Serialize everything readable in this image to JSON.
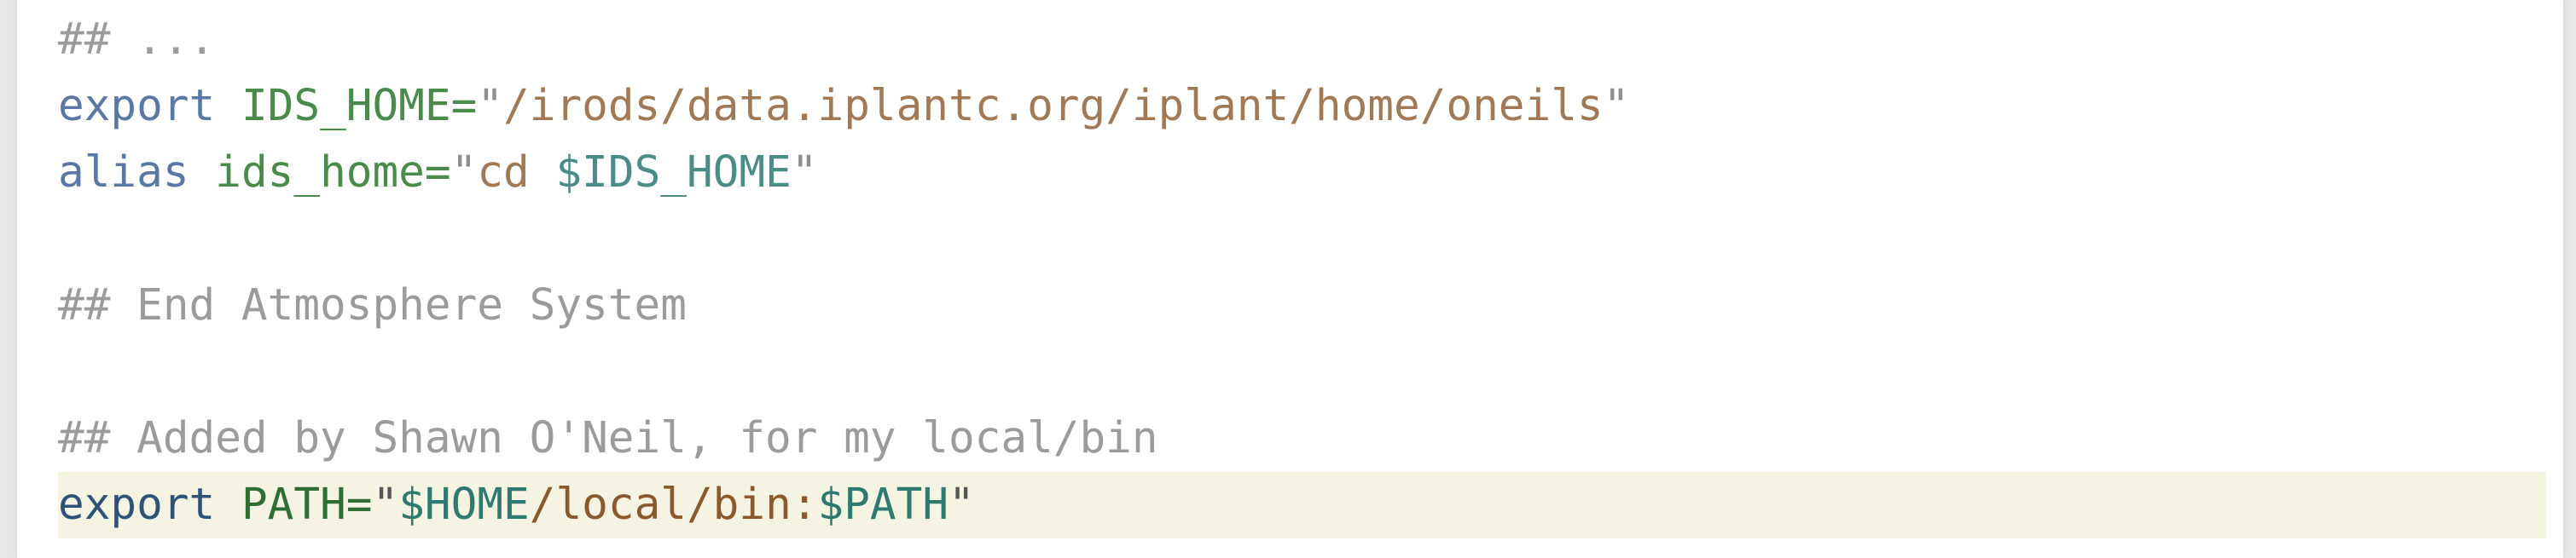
{
  "editor": {
    "lines": [
      {
        "tokens": [
          {
            "t": "comment",
            "v": "## ..."
          }
        ]
      },
      {
        "tokens": [
          {
            "t": "keyword",
            "v": "export"
          },
          {
            "t": "op",
            "v": " "
          },
          {
            "t": "var",
            "v": "IDS_HOME"
          },
          {
            "t": "var",
            "v": "="
          },
          {
            "t": "quote",
            "v": "\""
          },
          {
            "t": "string",
            "v": "/irods/data.iplantc.org/iplant/home/oneils"
          },
          {
            "t": "quote",
            "v": "\""
          }
        ]
      },
      {
        "tokens": [
          {
            "t": "keyword",
            "v": "alias"
          },
          {
            "t": "op",
            "v": " "
          },
          {
            "t": "var",
            "v": "ids_home"
          },
          {
            "t": "var",
            "v": "="
          },
          {
            "t": "quote",
            "v": "\""
          },
          {
            "t": "string",
            "v": "cd "
          },
          {
            "t": "dollar",
            "v": "$IDS_HOME"
          },
          {
            "t": "quote",
            "v": "\""
          }
        ]
      },
      {
        "tokens": []
      },
      {
        "tokens": [
          {
            "t": "comment",
            "v": "## End Atmosphere System"
          }
        ]
      },
      {
        "tokens": []
      },
      {
        "tokens": [
          {
            "t": "comment",
            "v": "## Added by Shawn O'Neil, for my local/bin"
          }
        ]
      },
      {
        "current": true,
        "tokens": [
          {
            "t": "keyword",
            "v": "export"
          },
          {
            "t": "op",
            "v": " "
          },
          {
            "t": "var",
            "v": "PATH"
          },
          {
            "t": "var",
            "v": "="
          },
          {
            "t": "quote",
            "v": "\""
          },
          {
            "t": "dollar",
            "v": "$HOME"
          },
          {
            "t": "string",
            "v": "/local/bin:"
          },
          {
            "t": "dollar",
            "v": "$PATH"
          },
          {
            "t": "quote",
            "v": "\""
          }
        ]
      }
    ]
  }
}
